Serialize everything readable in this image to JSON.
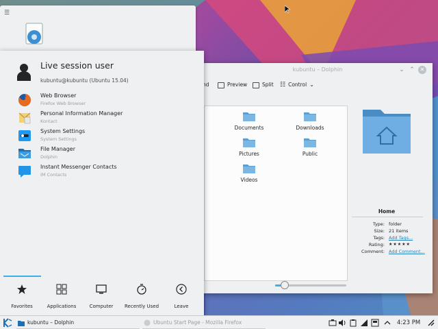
{
  "launcher": {
    "user_name": "Live session user",
    "user_host": "kubuntu@kubuntu (Ubuntu 15.04)",
    "favorites": [
      {
        "name": "Web Browser",
        "desc": "Firefox Web Browser",
        "icon": "firefox-icon"
      },
      {
        "name": "Personal Information Manager",
        "desc": "Kontact",
        "icon": "kontact-icon"
      },
      {
        "name": "System Settings",
        "desc": "System Settings",
        "icon": "settings-icon"
      },
      {
        "name": "File Manager",
        "desc": "Dolphin",
        "icon": "folder-icon"
      },
      {
        "name": "Instant Messenger Contacts",
        "desc": "IM Contacts",
        "icon": "chat-icon"
      }
    ],
    "tabs": [
      {
        "label": "Favorites",
        "icon": "star-icon"
      },
      {
        "label": "Applications",
        "icon": "grid-icon"
      },
      {
        "label": "Computer",
        "icon": "monitor-icon"
      },
      {
        "label": "Recently Used",
        "icon": "clock-icon"
      },
      {
        "label": "Leave",
        "icon": "back-icon"
      }
    ]
  },
  "dolphin": {
    "title": "kubuntu – Dolphin",
    "toolbar": {
      "find": "nd",
      "preview": "Preview",
      "split": "Split",
      "control": "Control"
    },
    "folders": [
      "Documents",
      "Downloads",
      "Pictures",
      "Public",
      "Videos"
    ],
    "info": {
      "title": "Home",
      "type_label": "Type:",
      "type_value": "folder",
      "size_label": "Size:",
      "size_value": "21 items",
      "tags_label": "Tags:",
      "tags_value": "Add Tags...",
      "rating_label": "Rating:",
      "rating_value": "★★★★★",
      "comment_label": "Comment:",
      "comment_value": "Add Comment..."
    },
    "zoom_level": 0.12
  },
  "taskbar": {
    "tasks": [
      {
        "label": "kubuntu – Dolphin",
        "active": true
      },
      {
        "label": "Ubuntu Start Page - Mozilla Firefox",
        "active": false
      }
    ],
    "clock": "4:23 PM"
  },
  "colors": {
    "accent": "#3daee9",
    "folder_blue": "#5a9fd4",
    "window_bg": "#eff0f1",
    "link": "#2980b9"
  }
}
